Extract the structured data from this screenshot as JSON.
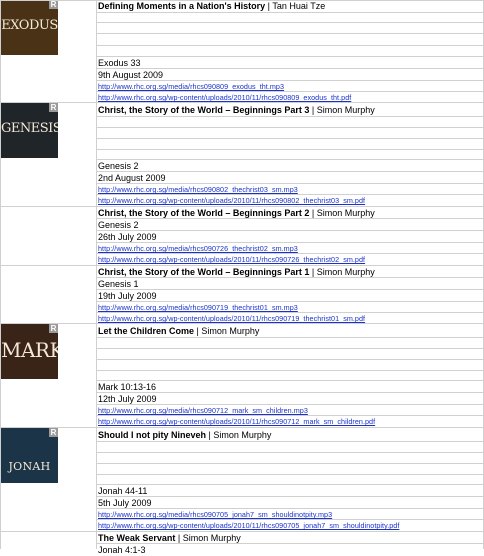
{
  "sermons": [
    {
      "title": "Defining Moments in a Nation's History",
      "speaker": " | Tan Huai Tze",
      "passage": "Exodus 33",
      "date": "9th August 2009",
      "mp3": "http://www.rhc.org.sg/media/rhcs090809_exodus_tht.mp3",
      "pdf": "http://www.rhc.org.sg/wp-content/uploads/2010/11/rhcs090809_exodus_tht.pdf",
      "thumb": {
        "word": "EXODUS",
        "bg": "#4a3216",
        "badge": "R"
      }
    },
    {
      "title": "Christ, the Story of the World – Beginnings Part 3",
      "speaker": " | Simon Murphy",
      "passage": "Genesis 2",
      "date": "2nd August 2009",
      "mp3": "http://www.rhc.org.sg/media/rhcs090802_thechrist03_sm.mp3",
      "pdf": "http://www.rhc.org.sg/wp-content/uploads/2010/11/rhcs090802_thechrist03_sm.pdf",
      "thumb": {
        "word": "GENESIS",
        "bg": "#1f2528",
        "badge": "R"
      }
    },
    {
      "title": "Christ, the Story of the World – Beginnings Part 2",
      "speaker": " | Simon Murphy",
      "passage": "Genesis 2",
      "date": "26th July 2009",
      "mp3": "http://www.rhc.org.sg/media/rhcs090726_thechrist02_sm.mp3",
      "pdf": "http://www.rhc.org.sg/wp-content/uploads/2010/11/rhcs090726_thechrist02_sm.pdf"
    },
    {
      "title": "Christ, the Story of the World – Beginnings Part 1",
      "speaker": " | Simon Murphy",
      "passage": "Genesis 1",
      "date": "19th July 2009",
      "mp3": "http://www.rhc.org.sg/media/rhcs090719_thechrist01_sm.mp3",
      "pdf": "http://www.rhc.org.sg/wp-content/uploads/2010/11/rhcs090719_thechrist01_sm.pdf"
    },
    {
      "title": "Let the Children Come",
      "speaker": " | Simon Murphy",
      "passage": "Mark 10:13-16",
      "date": "12th July 2009",
      "mp3": "http://www.rhc.org.sg/media/rhcs090712_mark_sm_children.mp3",
      "pdf": "http://www.rhc.org.sg/wp-content/uploads/2010/11/rhcs090712_mark_sm_children.pdf",
      "thumb": {
        "word": "MARK",
        "bg": "#3a2418",
        "badge": "R"
      }
    },
    {
      "title": "Should I not pity Nineveh",
      "speaker": " | Simon Murphy",
      "passage": "Jonah 44-11",
      "date": "5th July 2009",
      "mp3": "http://www.rhc.org.sg/media/rhcs090705_jonah7_sm_shouldinotpity.mp3",
      "pdf": "http://www.rhc.org.sg/wp-content/uploads/2010/11/rhcs090705_jonah7_sm_shouldinotpity.pdf",
      "thumb": {
        "word": "JONAH",
        "bg": "#1c3448",
        "badge": "R"
      }
    },
    {
      "title": "The Weak Servant",
      "speaker": " | Simon Murphy",
      "passage": "Jonah 4:1-3",
      "date": "",
      "mp3": "",
      "pdf": ""
    }
  ],
  "colors": {
    "grid": "#d0d0d0",
    "link": "#1a32c8"
  }
}
